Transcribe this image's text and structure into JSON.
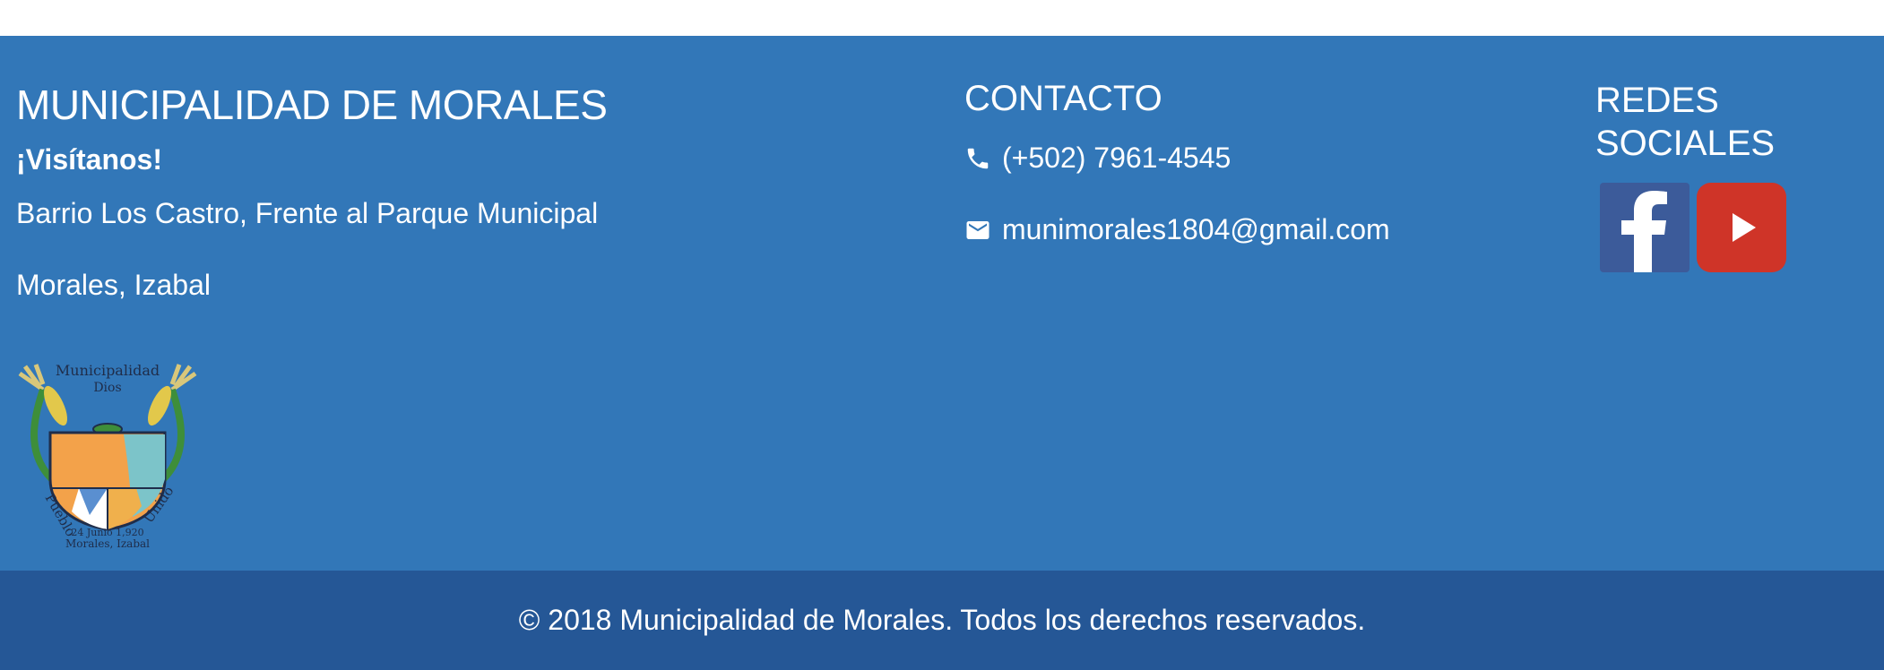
{
  "footer": {
    "left": {
      "title": "MUNICIPALIDAD DE MORALES",
      "visit": "¡Visítanos!",
      "address_line1": "Barrio Los Castro, Frente al Parque Municipal",
      "address_line2": "Morales, Izabal",
      "crest": {
        "top_text": "Municipalidad",
        "sub_text": "Dios",
        "left_text": "Pueblo",
        "right_text": "Unido",
        "date_text": "24 Junio 1,920",
        "place_text": "Morales, Izabal"
      }
    },
    "contact": {
      "title": "CONTACTO",
      "phone": "(+502) 7961-4545",
      "phone_icon": "phone-icon",
      "email": "munimorales1804@gmail.com",
      "email_icon": "mail-icon"
    },
    "social": {
      "title": "REDES SOCIALES",
      "items": [
        {
          "name": "facebook",
          "icon": "facebook-icon",
          "color": "#3c5b9a"
        },
        {
          "name": "youtube",
          "icon": "youtube-icon",
          "color": "#cf3428"
        }
      ]
    },
    "copyright": "© 2018 Municipalidad de Morales. Todos los derechos reservados."
  },
  "colors": {
    "footer_bg": "#3277b8",
    "bottom_bar_bg": "#255796",
    "text": "#ffffff"
  }
}
